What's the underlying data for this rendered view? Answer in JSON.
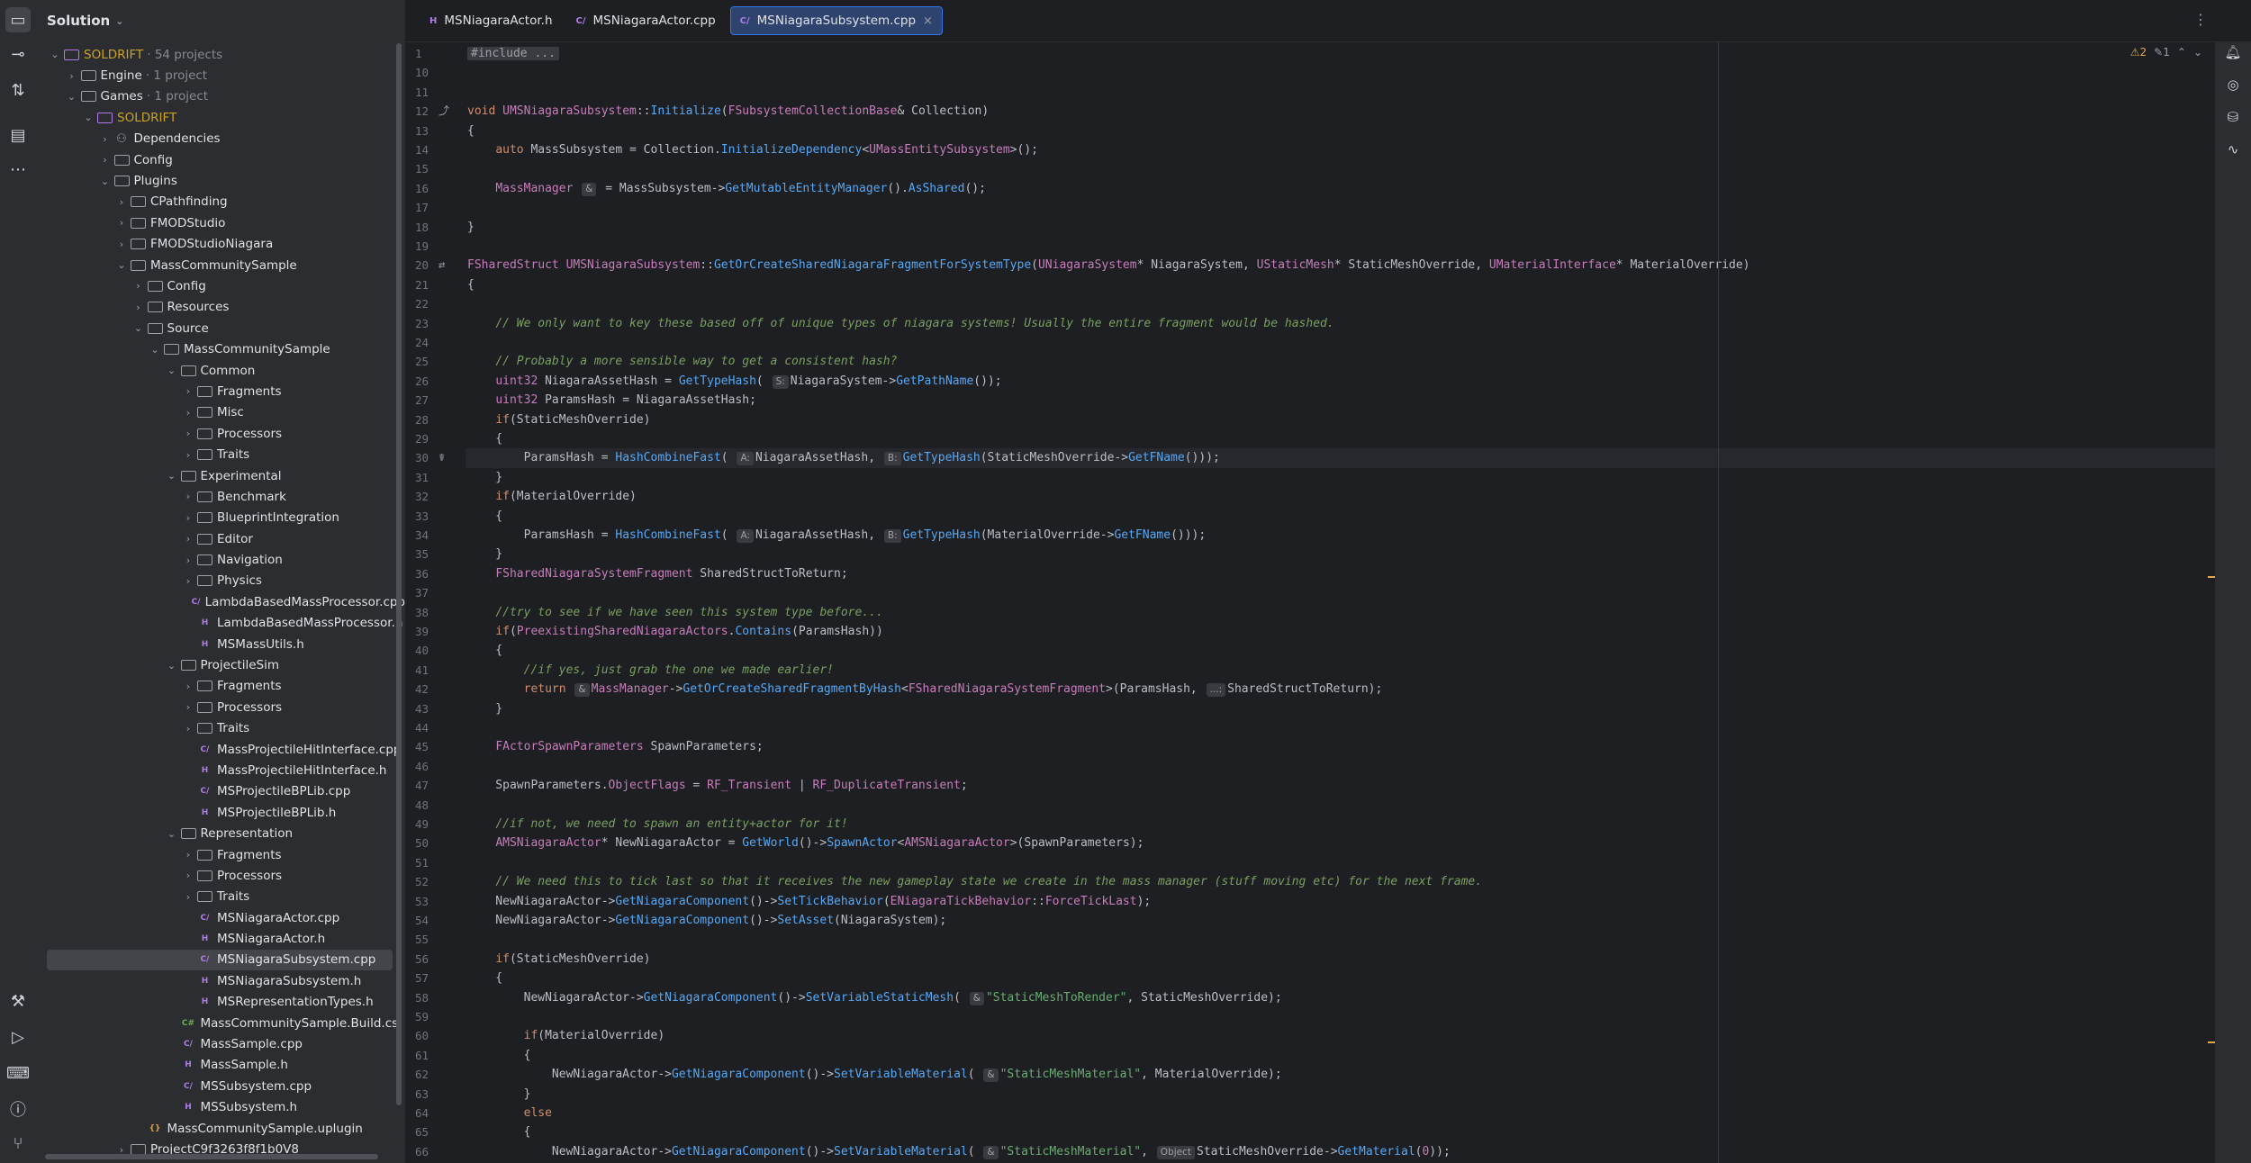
{
  "panel": {
    "title": "Solution"
  },
  "tree": [
    {
      "label": "SOLDRIFT",
      "meta": "· 54 projects",
      "icon": "sol",
      "depth": 0,
      "arrow": "open",
      "gold": true
    },
    {
      "label": "Engine",
      "meta": "· 1 project",
      "icon": "folder",
      "depth": 1,
      "arrow": "closed"
    },
    {
      "label": "Games",
      "meta": "· 1 project",
      "icon": "folder",
      "depth": 1,
      "arrow": "open"
    },
    {
      "label": "SOLDRIFT",
      "meta": "",
      "icon": "sol",
      "depth": 2,
      "arrow": "open",
      "gold": true
    },
    {
      "label": "Dependencies",
      "meta": "",
      "icon": "dep",
      "depth": 3,
      "arrow": "closed"
    },
    {
      "label": "Config",
      "meta": "",
      "icon": "folder",
      "depth": 3,
      "arrow": "closed"
    },
    {
      "label": "Plugins",
      "meta": "",
      "icon": "folder",
      "depth": 3,
      "arrow": "open"
    },
    {
      "label": "CPathfinding",
      "meta": "",
      "icon": "folder",
      "depth": 4,
      "arrow": "closed"
    },
    {
      "label": "FMODStudio",
      "meta": "",
      "icon": "folder",
      "depth": 4,
      "arrow": "closed"
    },
    {
      "label": "FMODStudioNiagara",
      "meta": "",
      "icon": "folder",
      "depth": 4,
      "arrow": "closed"
    },
    {
      "label": "MassCommunitySample",
      "meta": "",
      "icon": "folder",
      "depth": 4,
      "arrow": "open"
    },
    {
      "label": "Config",
      "meta": "",
      "icon": "folder",
      "depth": 5,
      "arrow": "closed"
    },
    {
      "label": "Resources",
      "meta": "",
      "icon": "folder",
      "depth": 5,
      "arrow": "closed"
    },
    {
      "label": "Source",
      "meta": "",
      "icon": "folder",
      "depth": 5,
      "arrow": "open"
    },
    {
      "label": "MassCommunitySample",
      "meta": "",
      "icon": "folder",
      "depth": 6,
      "arrow": "open"
    },
    {
      "label": "Common",
      "meta": "",
      "icon": "folder",
      "depth": 7,
      "arrow": "open"
    },
    {
      "label": "Fragments",
      "meta": "",
      "icon": "folder",
      "depth": 8,
      "arrow": "closed"
    },
    {
      "label": "Misc",
      "meta": "",
      "icon": "folder",
      "depth": 8,
      "arrow": "closed"
    },
    {
      "label": "Processors",
      "meta": "",
      "icon": "folder",
      "depth": 8,
      "arrow": "closed"
    },
    {
      "label": "Traits",
      "meta": "",
      "icon": "folder",
      "depth": 8,
      "arrow": "closed"
    },
    {
      "label": "Experimental",
      "meta": "",
      "icon": "folder",
      "depth": 7,
      "arrow": "open"
    },
    {
      "label": "Benchmark",
      "meta": "",
      "icon": "folder",
      "depth": 8,
      "arrow": "closed"
    },
    {
      "label": "BlueprintIntegration",
      "meta": "",
      "icon": "folder",
      "depth": 8,
      "arrow": "closed"
    },
    {
      "label": "Editor",
      "meta": "",
      "icon": "folder",
      "depth": 8,
      "arrow": "closed"
    },
    {
      "label": "Navigation",
      "meta": "",
      "icon": "folder",
      "depth": 8,
      "arrow": "closed"
    },
    {
      "label": "Physics",
      "meta": "",
      "icon": "folder",
      "depth": 8,
      "arrow": "closed"
    },
    {
      "label": "LambdaBasedMassProcessor.cpp",
      "meta": "",
      "icon": "cpp",
      "depth": 8,
      "arrow": ""
    },
    {
      "label": "LambdaBasedMassProcessor.h",
      "meta": "",
      "icon": "h",
      "depth": 8,
      "arrow": ""
    },
    {
      "label": "MSMassUtils.h",
      "meta": "",
      "icon": "h",
      "depth": 8,
      "arrow": ""
    },
    {
      "label": "ProjectileSim",
      "meta": "",
      "icon": "folder",
      "depth": 7,
      "arrow": "open"
    },
    {
      "label": "Fragments",
      "meta": "",
      "icon": "folder",
      "depth": 8,
      "arrow": "closed"
    },
    {
      "label": "Processors",
      "meta": "",
      "icon": "folder",
      "depth": 8,
      "arrow": "closed"
    },
    {
      "label": "Traits",
      "meta": "",
      "icon": "folder",
      "depth": 8,
      "arrow": "closed"
    },
    {
      "label": "MassProjectileHitInterface.cpp",
      "meta": "",
      "icon": "cpp",
      "depth": 8,
      "arrow": ""
    },
    {
      "label": "MassProjectileHitInterface.h",
      "meta": "",
      "icon": "h",
      "depth": 8,
      "arrow": ""
    },
    {
      "label": "MSProjectileBPLib.cpp",
      "meta": "",
      "icon": "cpp",
      "depth": 8,
      "arrow": ""
    },
    {
      "label": "MSProjectileBPLib.h",
      "meta": "",
      "icon": "h",
      "depth": 8,
      "arrow": ""
    },
    {
      "label": "Representation",
      "meta": "",
      "icon": "folder",
      "depth": 7,
      "arrow": "open"
    },
    {
      "label": "Fragments",
      "meta": "",
      "icon": "folder",
      "depth": 8,
      "arrow": "closed"
    },
    {
      "label": "Processors",
      "meta": "",
      "icon": "folder",
      "depth": 8,
      "arrow": "closed"
    },
    {
      "label": "Traits",
      "meta": "",
      "icon": "folder",
      "depth": 8,
      "arrow": "closed"
    },
    {
      "label": "MSNiagaraActor.cpp",
      "meta": "",
      "icon": "cpp",
      "depth": 8,
      "arrow": ""
    },
    {
      "label": "MSNiagaraActor.h",
      "meta": "",
      "icon": "h",
      "depth": 8,
      "arrow": ""
    },
    {
      "label": "MSNiagaraSubsystem.cpp",
      "meta": "",
      "icon": "cpp",
      "depth": 8,
      "arrow": "",
      "selected": true
    },
    {
      "label": "MSNiagaraSubsystem.h",
      "meta": "",
      "icon": "h",
      "depth": 8,
      "arrow": ""
    },
    {
      "label": "MSRepresentationTypes.h",
      "meta": "",
      "icon": "h",
      "depth": 8,
      "arrow": ""
    },
    {
      "label": "MassCommunitySample.Build.cs",
      "meta": "",
      "icon": "cs",
      "depth": 7,
      "arrow": ""
    },
    {
      "label": "MassSample.cpp",
      "meta": "",
      "icon": "cpp",
      "depth": 7,
      "arrow": ""
    },
    {
      "label": "MassSample.h",
      "meta": "",
      "icon": "h",
      "depth": 7,
      "arrow": ""
    },
    {
      "label": "MSSubsystem.cpp",
      "meta": "",
      "icon": "cpp",
      "depth": 7,
      "arrow": ""
    },
    {
      "label": "MSSubsystem.h",
      "meta": "",
      "icon": "h",
      "depth": 7,
      "arrow": ""
    },
    {
      "label": "MassCommunitySample.uplugin",
      "meta": "",
      "icon": "up",
      "depth": 5,
      "arrow": ""
    },
    {
      "label": "ProjectC9f3263f8f1b0V8",
      "meta": "",
      "icon": "folder",
      "depth": 4,
      "arrow": "closed"
    }
  ],
  "tabs": [
    {
      "label": "MSNiagaraActor.h",
      "kind": "H",
      "active": false
    },
    {
      "label": "MSNiagaraActor.cpp",
      "kind": "C/",
      "active": false
    },
    {
      "label": "MSNiagaraSubsystem.cpp",
      "kind": "C/",
      "active": true
    }
  ],
  "inspect": {
    "warnings": "2",
    "weak": "1"
  },
  "gutter": [
    "1",
    "10",
    "11",
    "12",
    "13",
    "14",
    "15",
    "16",
    "17",
    "18",
    "19",
    "20",
    "21",
    "22",
    "23",
    "24",
    "25",
    "26",
    "27",
    "28",
    "29",
    "30",
    "31",
    "32",
    "33",
    "34",
    "35",
    "36",
    "37",
    "38",
    "39",
    "40",
    "41",
    "42",
    "43",
    "44",
    "45",
    "46",
    "47",
    "48",
    "49",
    "50",
    "51",
    "52",
    "53",
    "54",
    "55",
    "56",
    "57",
    "58",
    "59",
    "60",
    "61",
    "62",
    "63",
    "64",
    "65",
    "66"
  ],
  "code": [
    [
      [
        "fold",
        "#include ..."
      ]
    ],
    [],
    [],
    [
      [
        "kw",
        "void "
      ],
      [
        "ty",
        "UMSNiagaraSubsystem"
      ],
      [
        "p",
        "::"
      ],
      [
        "fn",
        "Initialize"
      ],
      [
        "p",
        "("
      ],
      [
        "ty",
        "FSubsystemCollectionBase"
      ],
      [
        "p",
        "& Collection)"
      ]
    ],
    [
      [
        "p",
        "{"
      ]
    ],
    [
      [
        "p",
        "    "
      ],
      [
        "kw",
        "auto "
      ],
      [
        "p",
        "MassSubsystem = Collection."
      ],
      [
        "fn",
        "InitializeDependency"
      ],
      [
        "p",
        "<"
      ],
      [
        "ty",
        "UMassEntitySubsystem"
      ],
      [
        "p",
        ">();"
      ]
    ],
    [],
    [
      [
        "p",
        "    "
      ],
      [
        "ty",
        "MassManager "
      ],
      [
        "hint",
        "&"
      ],
      [
        "p",
        " = MassSubsystem->"
      ],
      [
        "fn",
        "GetMutableEntityManager"
      ],
      [
        "p",
        "()."
      ],
      [
        "fn",
        "AsShared"
      ],
      [
        "p",
        "();"
      ]
    ],
    [],
    [
      [
        "p",
        "}"
      ]
    ],
    [],
    [
      [
        "ty",
        "FSharedStruct "
      ],
      [
        "ty",
        "UMSNiagaraSubsystem"
      ],
      [
        "p",
        "::"
      ],
      [
        "fn",
        "GetOrCreateSharedNiagaraFragmentForSystemType"
      ],
      [
        "p",
        "("
      ],
      [
        "ty",
        "UNiagaraSystem"
      ],
      [
        "p",
        "* NiagaraSystem, "
      ],
      [
        "ty",
        "UStaticMesh"
      ],
      [
        "p",
        "* StaticMeshOverride, "
      ],
      [
        "ty",
        "UMaterialInterface"
      ],
      [
        "p",
        "* MaterialOverride)"
      ]
    ],
    [
      [
        "p",
        "{"
      ]
    ],
    [],
    [
      [
        "p",
        "    "
      ],
      [
        "cm",
        "// We only want to key these based off of unique types of niagara systems! Usually the entire fragment would be hashed."
      ]
    ],
    [],
    [
      [
        "p",
        "    "
      ],
      [
        "cm",
        "// Probably a more sensible way to get a consistent hash?"
      ]
    ],
    [
      [
        "p",
        "    "
      ],
      [
        "ty",
        "uint32 "
      ],
      [
        "p",
        "NiagaraAssetHash = "
      ],
      [
        "fn",
        "GetTypeHash"
      ],
      [
        "p",
        "( "
      ],
      [
        "hint",
        "S:"
      ],
      [
        "p",
        "NiagaraSystem->"
      ],
      [
        "fn",
        "GetPathName"
      ],
      [
        "p",
        "());"
      ]
    ],
    [
      [
        "p",
        "    "
      ],
      [
        "ty",
        "uint32 "
      ],
      [
        "p",
        "ParamsHash = NiagaraAssetHash;"
      ]
    ],
    [
      [
        "p",
        "    "
      ],
      [
        "kw",
        "if"
      ],
      [
        "p",
        "(StaticMeshOverride)"
      ]
    ],
    [
      [
        "p",
        "    {"
      ]
    ],
    [
      [
        "p",
        "        ParamsHash = "
      ],
      [
        "fn",
        "HashCombineFast"
      ],
      [
        "p",
        "( "
      ],
      [
        "hint",
        "A:"
      ],
      [
        "p",
        "NiagaraAssetHash, "
      ],
      [
        "hint",
        "B:"
      ],
      [
        "fn",
        "GetTypeHash"
      ],
      [
        "p",
        "(StaticMeshOverride->"
      ],
      [
        "fn",
        "GetFName"
      ],
      [
        "p",
        "()));"
      ]
    ],
    [
      [
        "p",
        "    }"
      ]
    ],
    [
      [
        "p",
        "    "
      ],
      [
        "kw",
        "if"
      ],
      [
        "p",
        "(MaterialOverride)"
      ]
    ],
    [
      [
        "p",
        "    {"
      ]
    ],
    [
      [
        "p",
        "        ParamsHash = "
      ],
      [
        "fn",
        "HashCombineFast"
      ],
      [
        "p",
        "( "
      ],
      [
        "hint",
        "A:"
      ],
      [
        "p",
        "NiagaraAssetHash, "
      ],
      [
        "hint",
        "B:"
      ],
      [
        "fn",
        "GetTypeHash"
      ],
      [
        "p",
        "(MaterialOverride->"
      ],
      [
        "fn",
        "GetFName"
      ],
      [
        "p",
        "()));"
      ]
    ],
    [
      [
        "p",
        "    }"
      ]
    ],
    [
      [
        "p",
        "    "
      ],
      [
        "ty",
        "FSharedNiagaraSystemFragment "
      ],
      [
        "p",
        "SharedStructToReturn;"
      ]
    ],
    [],
    [
      [
        "p",
        "    "
      ],
      [
        "cm",
        "//try to see if we have seen this system type before..."
      ]
    ],
    [
      [
        "p",
        "    "
      ],
      [
        "kw",
        "if"
      ],
      [
        "p",
        "("
      ],
      [
        "ty",
        "PreexistingSharedNiagaraActors"
      ],
      [
        "p",
        "."
      ],
      [
        "fn",
        "Contains"
      ],
      [
        "p",
        "(ParamsHash))"
      ]
    ],
    [
      [
        "p",
        "    {"
      ]
    ],
    [
      [
        "p",
        "        "
      ],
      [
        "cm",
        "//if yes, just grab the one we made earlier!"
      ]
    ],
    [
      [
        "p",
        "        "
      ],
      [
        "kw",
        "return "
      ],
      [
        "hint",
        "&"
      ],
      [
        "ty",
        "MassManager"
      ],
      [
        "p",
        "->"
      ],
      [
        "fn",
        "GetOrCreateSharedFragmentByHash"
      ],
      [
        "p",
        "<"
      ],
      [
        "ty",
        "FSharedNiagaraSystemFragment"
      ],
      [
        "p",
        ">(ParamsHash, "
      ],
      [
        "hint",
        "...:"
      ],
      [
        "p",
        "SharedStructToReturn);"
      ]
    ],
    [
      [
        "p",
        "    }"
      ]
    ],
    [],
    [
      [
        "p",
        "    "
      ],
      [
        "ty",
        "FActorSpawnParameters "
      ],
      [
        "p",
        "SpawnParameters;"
      ]
    ],
    [],
    [
      [
        "p",
        "    SpawnParameters."
      ],
      [
        "ty",
        "ObjectFlags"
      ],
      [
        "p",
        " = "
      ],
      [
        "en",
        "RF_Transient"
      ],
      [
        "p",
        " | "
      ],
      [
        "en",
        "RF_DuplicateTransient"
      ],
      [
        "p",
        ";"
      ]
    ],
    [],
    [
      [
        "p",
        "    "
      ],
      [
        "cm",
        "//if not, we need to spawn an entity+actor for it!"
      ]
    ],
    [
      [
        "p",
        "    "
      ],
      [
        "ty",
        "AMSNiagaraActor"
      ],
      [
        "p",
        "* NewNiagaraActor = "
      ],
      [
        "fn",
        "GetWorld"
      ],
      [
        "p",
        "()->"
      ],
      [
        "fn",
        "SpawnActor"
      ],
      [
        "p",
        "<"
      ],
      [
        "ty",
        "AMSNiagaraActor"
      ],
      [
        "p",
        ">(SpawnParameters);"
      ]
    ],
    [],
    [
      [
        "p",
        "    "
      ],
      [
        "cm",
        "// We need this to tick last so that it receives the new gameplay state we create in the mass manager (stuff moving etc) for the next frame."
      ]
    ],
    [
      [
        "p",
        "    NewNiagaraActor->"
      ],
      [
        "fn",
        "GetNiagaraComponent"
      ],
      [
        "p",
        "()->"
      ],
      [
        "fn",
        "SetTickBehavior"
      ],
      [
        "p",
        "("
      ],
      [
        "ty",
        "ENiagaraTickBehavior"
      ],
      [
        "p",
        "::"
      ],
      [
        "en",
        "ForceTickLast"
      ],
      [
        "p",
        ");"
      ]
    ],
    [
      [
        "p",
        "    NewNiagaraActor->"
      ],
      [
        "fn",
        "GetNiagaraComponent"
      ],
      [
        "p",
        "()->"
      ],
      [
        "fn",
        "SetAsset"
      ],
      [
        "p",
        "(NiagaraSystem);"
      ]
    ],
    [],
    [
      [
        "p",
        "    "
      ],
      [
        "kw",
        "if"
      ],
      [
        "p",
        "(StaticMeshOverride)"
      ]
    ],
    [
      [
        "p",
        "    {"
      ]
    ],
    [
      [
        "p",
        "        NewNiagaraActor->"
      ],
      [
        "fn",
        "GetNiagaraComponent"
      ],
      [
        "p",
        "()->"
      ],
      [
        "fn",
        "SetVariableStaticMesh"
      ],
      [
        "p",
        "( "
      ],
      [
        "hint",
        "&"
      ],
      [
        "st",
        "\"StaticMeshToRender\""
      ],
      [
        "p",
        ", StaticMeshOverride);"
      ]
    ],
    [],
    [
      [
        "p",
        "        "
      ],
      [
        "kw",
        "if"
      ],
      [
        "p",
        "(MaterialOverride)"
      ]
    ],
    [
      [
        "p",
        "        {"
      ]
    ],
    [
      [
        "p",
        "            NewNiagaraActor->"
      ],
      [
        "fn",
        "GetNiagaraComponent"
      ],
      [
        "p",
        "()->"
      ],
      [
        "fn",
        "SetVariableMaterial"
      ],
      [
        "p",
        "( "
      ],
      [
        "hint",
        "&"
      ],
      [
        "st",
        "\"StaticMeshMaterial\""
      ],
      [
        "p",
        ", MaterialOverride);"
      ]
    ],
    [
      [
        "p",
        "        }"
      ]
    ],
    [
      [
        "p",
        "        "
      ],
      [
        "kw",
        "else"
      ]
    ],
    [
      [
        "p",
        "        {"
      ]
    ],
    [
      [
        "p",
        "            NewNiagaraActor->"
      ],
      [
        "fn",
        "GetNiagaraComponent"
      ],
      [
        "p",
        "()->"
      ],
      [
        "fn",
        "SetVariableMaterial"
      ],
      [
        "p",
        "( "
      ],
      [
        "hint",
        "&"
      ],
      [
        "st",
        "\"StaticMeshMaterial\""
      ],
      [
        "p",
        ", "
      ],
      [
        "hint",
        "Object"
      ],
      [
        "p",
        "StaticMeshOverride->"
      ],
      [
        "fn",
        "GetMaterial"
      ],
      [
        "p",
        "("
      ],
      [
        "en",
        "0"
      ],
      [
        "p",
        "));"
      ]
    ]
  ]
}
